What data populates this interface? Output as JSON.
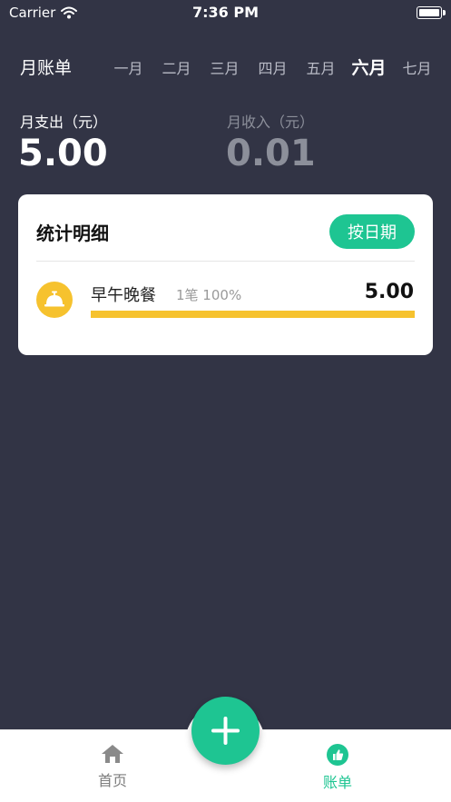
{
  "status": {
    "carrier": "Carrier",
    "time": "7:36 PM"
  },
  "header": {
    "title": "月账单",
    "months": [
      "一月",
      "二月",
      "三月",
      "四月",
      "五月",
      "六月",
      "七月"
    ],
    "selected_month": "六月"
  },
  "summary": {
    "expense_label": "月支出（元）",
    "expense_value": "5.00",
    "income_label": "月收入（元）",
    "income_value": "0.01"
  },
  "card": {
    "title": "统计明细",
    "by_date_button": "按日期",
    "items": [
      {
        "icon": "service-bell-icon",
        "name": "早午晚餐",
        "meta": "1笔 100%",
        "amount": "5.00",
        "percent": 100
      }
    ]
  },
  "tabbar": {
    "home_label": "首页",
    "bill_label": "账单",
    "add_icon": "plus-icon"
  },
  "colors": {
    "accent": "#1ec592",
    "background": "#323445",
    "category": "#f6c22e"
  }
}
